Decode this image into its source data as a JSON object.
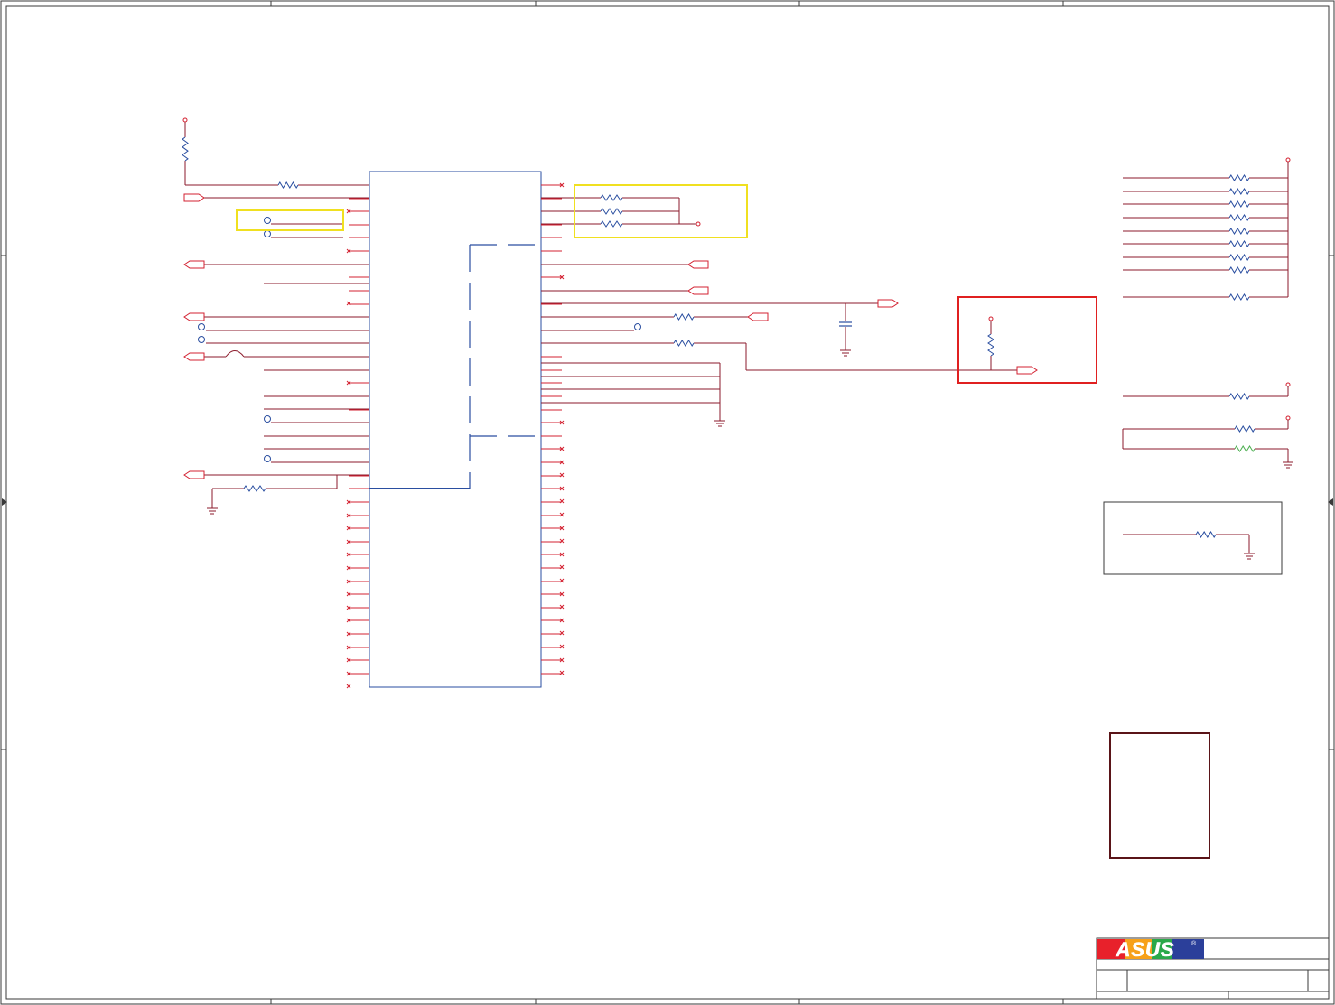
{
  "page": {
    "logo_text": "ASUS",
    "registered_mark": "®"
  },
  "colors": {
    "wire": "#8b1a2b",
    "pin_red": "#d32030",
    "component_blue": "#2a4ea0",
    "frame": "#3a3a3a",
    "highlight_yellow": "#f0e020",
    "highlight_red": "#e02020",
    "green_resistor": "#4caf50",
    "box_dark": "#5a1418"
  }
}
